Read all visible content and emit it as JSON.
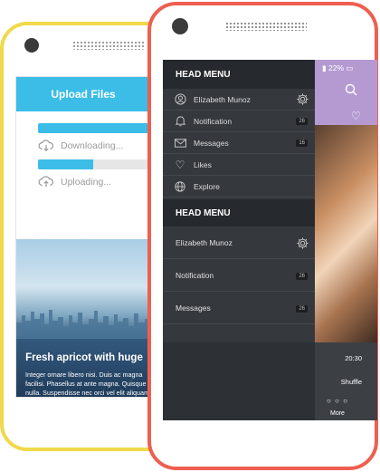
{
  "upload_app": {
    "header_title": "Upload Files",
    "download_label": "Downloading...",
    "download_progress": 0.95,
    "upload_label": "Uploading...",
    "upload_progress": 0.47,
    "promo_title": "Fresh apricot with huge",
    "promo_body": "Integer ornare libero nisi. Duis ac magna facilisi. Phasellus at ante magna. Quisque nulla. Suspendisse nec orci vel elit aliquam orci. Vivamus posuere dui eget"
  },
  "menu_app": {
    "status_battery": "22%",
    "head_menu_1": "HEAD MENU",
    "items": [
      {
        "label": "Elizabeth Munoz",
        "icon": "user-icon",
        "badge": ""
      },
      {
        "label": "Notification",
        "icon": "bell-icon",
        "badge": "26"
      },
      {
        "label": "Messages",
        "icon": "envelope-icon",
        "badge": "16"
      },
      {
        "label": "Likes",
        "icon": "heart-icon",
        "badge": ""
      },
      {
        "label": "Explore",
        "icon": "globe-icon",
        "badge": ""
      }
    ],
    "head_menu_2": "HEAD MENU",
    "items2": [
      {
        "label": "Elizabeth Munoz",
        "badge": ""
      },
      {
        "label": "Notification",
        "badge": "26"
      },
      {
        "label": "Messages",
        "badge": "26"
      }
    ],
    "player_time": "20:30",
    "player_shuffle": "Shuffle",
    "more_label": "More"
  },
  "colors": {
    "back_frame": "#f0d94a",
    "front_frame": "#ee5f50",
    "accent_blue": "#3bbde8",
    "drawer_bg": "#35393e"
  }
}
